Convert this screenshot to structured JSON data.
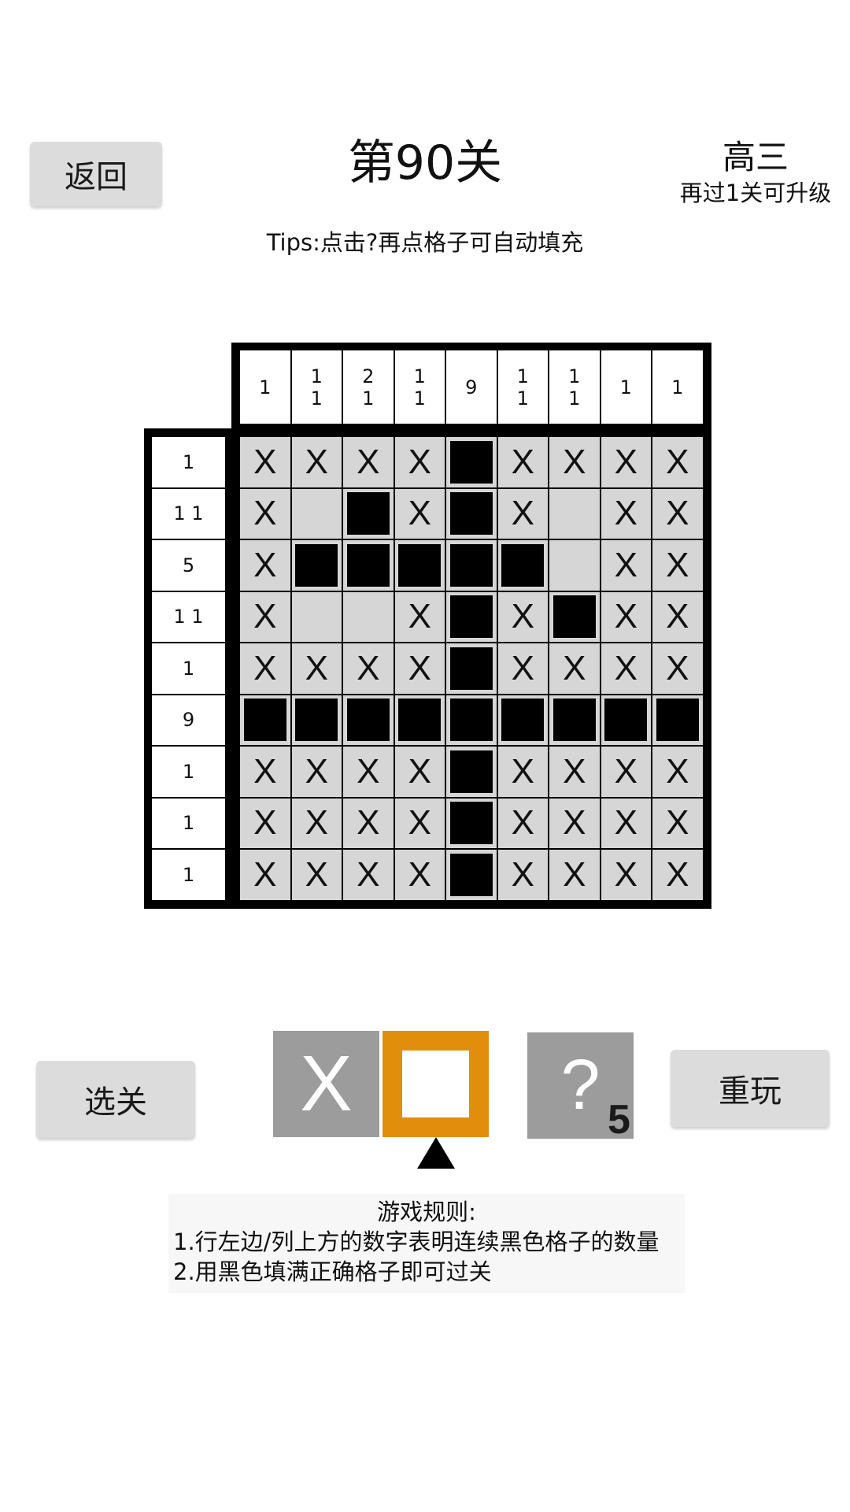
{
  "header": {
    "back_label": "返回",
    "level_title": "第90关",
    "grade": "高三",
    "grade_progress": "再过1关可升级",
    "tips": "Tips:点击?再点格子可自动填充"
  },
  "puzzle": {
    "size": 9,
    "column_clues": [
      "1",
      "1\n1",
      "2\n1",
      "1\n1",
      "9",
      "1\n1",
      "1\n1",
      "1",
      "1"
    ],
    "row_clues": [
      "1",
      "1 1",
      "5",
      "1 1",
      "1",
      "9",
      "1",
      "1",
      "1"
    ],
    "grid": [
      "XXXX#XXXX",
      "X.#X#X.XX",
      "X#####.XX",
      "X..X#X#XX",
      "XXXX#XXXX",
      "#########",
      "XXXX#XXXX",
      "XXXX#XXXX",
      "XXXX#XXXX"
    ],
    "cell_mark_x": "X"
  },
  "tools": {
    "x_label": "X",
    "hint_label": "?",
    "hint_count": "5",
    "selected": "fill",
    "fill_color": "#e08e0b"
  },
  "buttons": {
    "select_level": "选关",
    "replay": "重玩"
  },
  "rules": {
    "title": "游戏规则:",
    "lines": [
      "1.行左边/列上方的数字表明连续黑色格子的数量",
      "2.用黑色填满正确格子即可过关"
    ]
  }
}
